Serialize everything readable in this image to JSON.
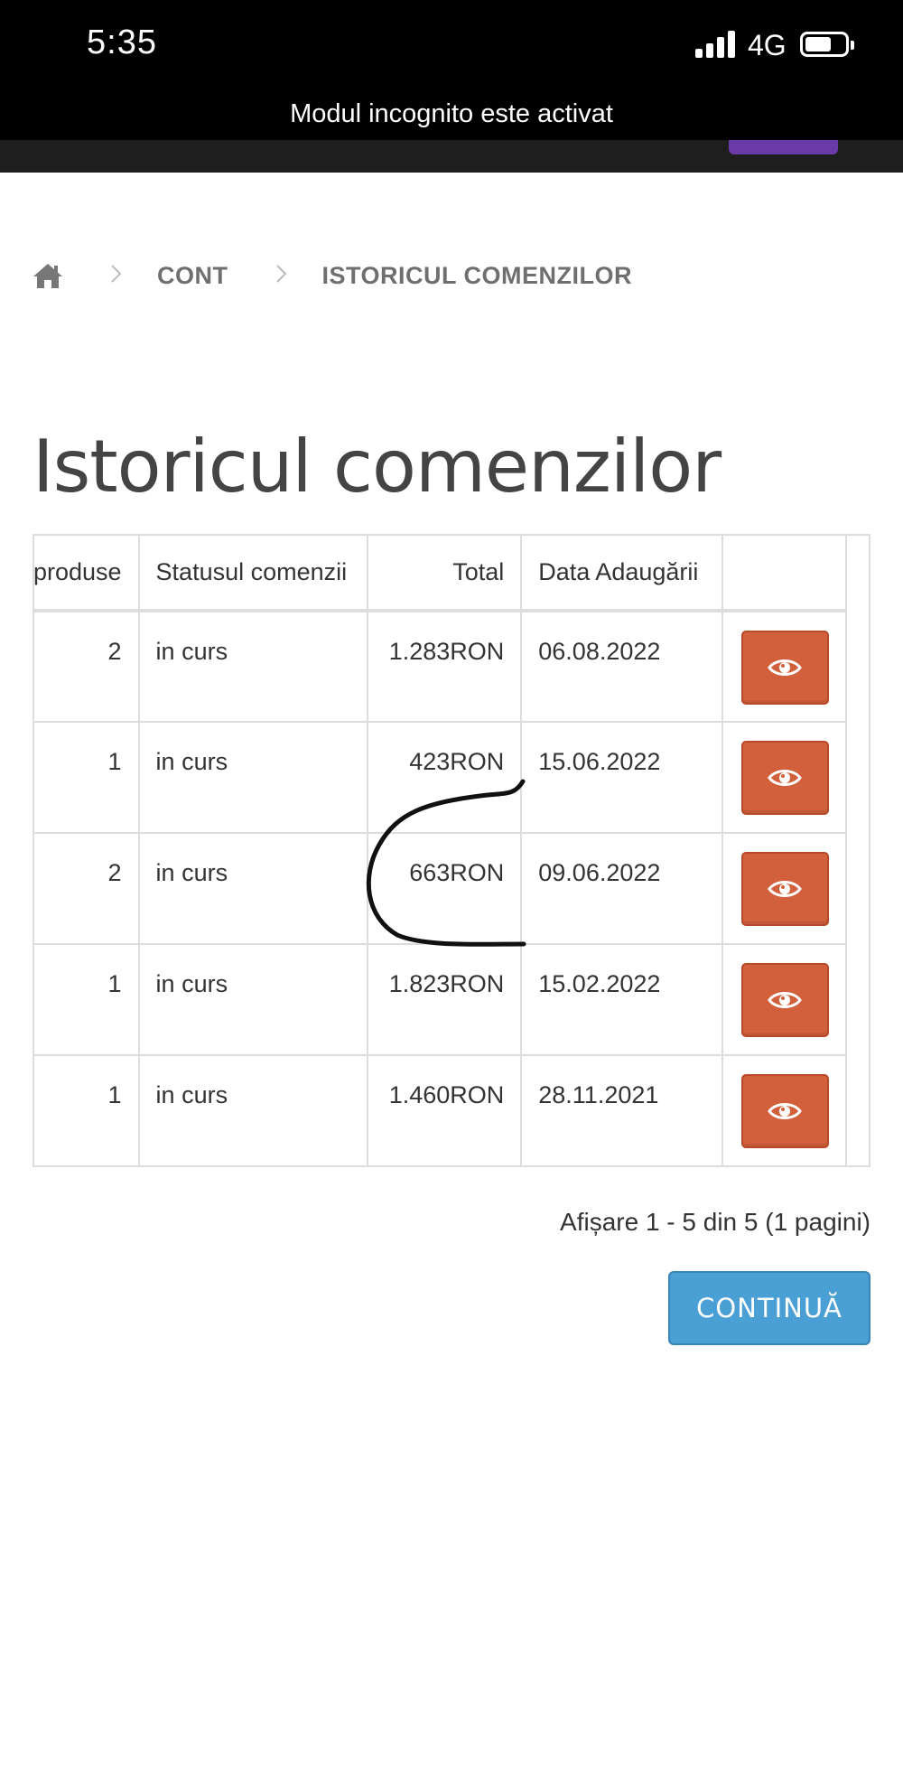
{
  "status_bar": {
    "time": "5:35",
    "network": "4G",
    "incognito_text": "Modul incognito este activat"
  },
  "breadcrumb": {
    "home_icon": "home-icon",
    "items": [
      "CONT",
      "ISTORICUL COMENZILOR"
    ]
  },
  "page_title": "Istoricul comenzilor",
  "orders_table": {
    "headers": {
      "products": "produse",
      "status": "Statusul comenzii",
      "total": "Total",
      "date": "Data Adaugării"
    },
    "rows": [
      {
        "products": "2",
        "status": "in curs",
        "total": "1.283RON",
        "date": "06.08.2022"
      },
      {
        "products": "1",
        "status": "in curs",
        "total": "423RON",
        "date": "15.06.2022"
      },
      {
        "products": "2",
        "status": "in curs",
        "total": "663RON",
        "date": "09.06.2022"
      },
      {
        "products": "1",
        "status": "in curs",
        "total": "1.823RON",
        "date": "15.02.2022"
      },
      {
        "products": "1",
        "status": "in curs",
        "total": "1.460RON",
        "date": "28.11.2021"
      }
    ],
    "action_icon": "eye-icon"
  },
  "pagination_info": "Afișare 1 - 5 din 5 (1 pagini)",
  "continue_label": "CONTINUĂ",
  "colors": {
    "view_button": "#d2603c",
    "continue_button": "#4a9fd4",
    "app_bar_accent": "#6a3aa8"
  }
}
